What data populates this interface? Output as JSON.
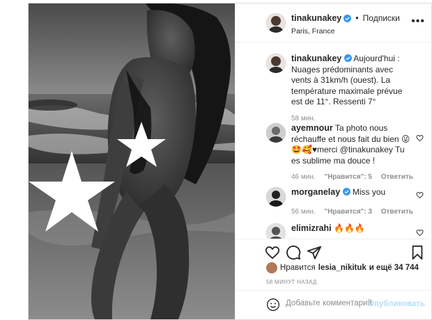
{
  "header": {
    "username": "tinakunakey",
    "separator": "•",
    "follow_label": "Подписки",
    "location": "Paris, France",
    "more_icon": "more-horizontal-icon"
  },
  "caption": {
    "username": "tinakunakey",
    "text": "Aujourd'hui : Nuages prédominants avec vents à 31km/h (ouest). La température maximale prévue est de 11°. Ressenti 7°",
    "time": "58 мин."
  },
  "comments": [
    {
      "username": "ayemnour",
      "text": "Ta photo nous réchauffe et nous fait du bien 😜 🤩🥰♥merci @tinakunakey Tu es sublime ma douce !",
      "time": "46 мин.",
      "likes": "\"Нравится\": 5",
      "reply": "Ответить"
    },
    {
      "username": "morganelay",
      "text": "Miss you",
      "time": "56 мин.",
      "likes": "\"Нравится\": 3",
      "reply": "Ответить"
    },
    {
      "username": "elimizrahi",
      "text": "🔥🔥🔥"
    }
  ],
  "likes": {
    "prefix": "Нравится",
    "user": "lesia_nikituk",
    "suffix": "и ещё 34 744"
  },
  "time_ago": "58 МИНУТ НАЗАД",
  "add_comment": {
    "placeholder": "Добавьте комментарий...",
    "post_label": "Опубликовать"
  },
  "colors": {
    "verified": "#3897f0",
    "link": "#00376b",
    "post_disabled": "#b2dffc"
  }
}
